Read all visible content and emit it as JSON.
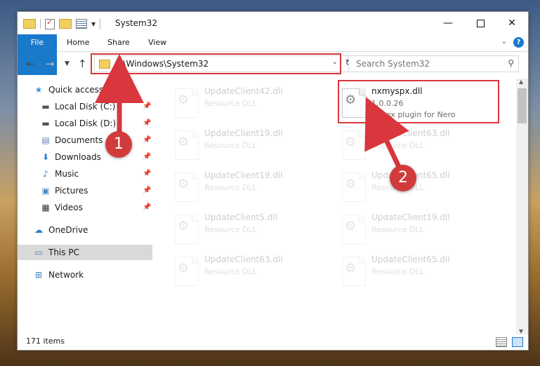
{
  "window": {
    "title": "System32"
  },
  "ribbon": {
    "tabs": [
      "File",
      "Home",
      "Share",
      "View"
    ],
    "help": "?"
  },
  "nav": {
    "address": "C:\\Windows\\System32",
    "search_placeholder": "Search System32"
  },
  "sidebar": {
    "items": [
      {
        "label": "Quick access",
        "icon": "star-icon"
      },
      {
        "label": "Local Disk (C:)",
        "icon": "drive-icon"
      },
      {
        "label": "Local Disk (D:)",
        "icon": "drive-icon"
      },
      {
        "label": "Documents",
        "icon": "documents-icon"
      },
      {
        "label": "Downloads",
        "icon": "download-icon"
      },
      {
        "label": "Music",
        "icon": "music-icon"
      },
      {
        "label": "Pictures",
        "icon": "pictures-icon"
      },
      {
        "label": "Videos",
        "icon": "videos-icon"
      },
      {
        "label": "OneDrive",
        "icon": "cloud-icon"
      },
      {
        "label": "This PC",
        "icon": "computer-icon"
      },
      {
        "label": "Network",
        "icon": "network-icon"
      }
    ]
  },
  "files": {
    "highlighted": {
      "name": "nxmyspx.dll",
      "version": "1.0.0.26",
      "description": "Speex plugin for Nero"
    },
    "left_column": [
      {
        "name": "UpdateClient42.dll",
        "type": "Resource DLL"
      },
      {
        "name": "UpdateClient19.dll",
        "type": "Resource DLL"
      },
      {
        "name": "UpdateClient19.dll",
        "type": "Resource DLL"
      },
      {
        "name": "UpdateClient5.dll",
        "type": "Resource DLL"
      },
      {
        "name": "UpdateClient63.dll",
        "type": "Resource DLL"
      }
    ],
    "right_column": [
      {
        "name": "UpdateClient63.dll",
        "type": "Resource DLL"
      },
      {
        "name": "UpdateClient65.dll",
        "type": "Resource DLL"
      },
      {
        "name": "UpdateClient19.dll",
        "type": "Resource DLL"
      },
      {
        "name": "UpdateClient65.dll",
        "type": "Resource DLL"
      }
    ]
  },
  "status": {
    "count": "171 items"
  },
  "annotations": {
    "step1": "1",
    "step2": "2",
    "color": "#d9363e"
  }
}
